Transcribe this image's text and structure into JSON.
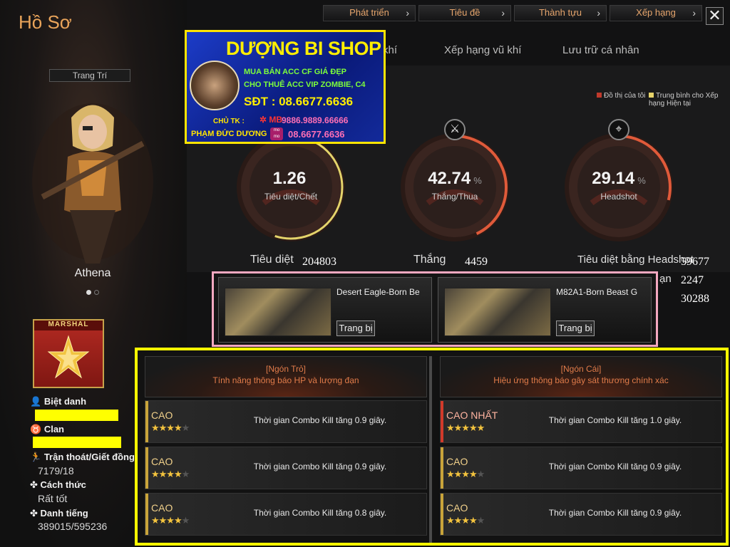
{
  "window": {
    "title": "Hồ Sơ"
  },
  "top_tabs": [
    {
      "label": "Phát triển"
    },
    {
      "label": "Tiêu đề"
    },
    {
      "label": "Thành tựu"
    },
    {
      "label": "Xếp hạng"
    }
  ],
  "close_icon": "close-icon",
  "nav_tabs": [
    {
      "label": "khí"
    },
    {
      "label": "Xếp hạng vũ khí"
    },
    {
      "label": "Lưu trữ cá nhân"
    }
  ],
  "character": {
    "decoration_label": "Trang Trí",
    "name": "Athena",
    "rank_label": "MARSHAL"
  },
  "profile": {
    "nickname_label": "Biệt danh",
    "clan_label": "Clan",
    "escape_label": "Trận thoát/Giết đồng đ",
    "escape_value": "7179/18",
    "manner_label": "Cách thức",
    "manner_value": "Rất tốt",
    "reputation_label": "Danh tiếng",
    "reputation_value": "389015/595236"
  },
  "legend": {
    "mine": "Đồ thị của tôi",
    "average": "Trung bình cho Xếp hạng Hiện tại",
    "mine_color": "#c0392b",
    "average_color": "#e6d36a"
  },
  "gauges": [
    {
      "value": "1.26",
      "unit": "",
      "label": "Tiêu diệt/Chết",
      "fraction": 0.55,
      "icon": ""
    },
    {
      "value": "42.74",
      "unit": "%",
      "label": "Thắng/Thua",
      "fraction": 0.43,
      "icon": "crossed-rifles-icon"
    },
    {
      "value": "29.14",
      "unit": "%",
      "label": "Headshot",
      "fraction": 0.29,
      "icon": "sniper-icon"
    }
  ],
  "stats": {
    "kills_label": "Tiêu diệt",
    "kills_value": "204803",
    "wins_label": "Thắng",
    "wins_value": "4459",
    "headshot_kills_label": "Tiêu diệt bằng Headshot",
    "headshot_kills_value": "59677",
    "row2_label_fragment": "ạn",
    "row2_value": "2247",
    "row3_value": "30288"
  },
  "weapons": [
    {
      "name": "Desert Eagle-Born Be",
      "button": "Trang bị"
    },
    {
      "name": "M82A1-Born Beast G",
      "button": "Trang bị"
    }
  ],
  "effects": {
    "left": {
      "title": "[Ngón Trỏ]",
      "subtitle": "Tính năng thông báo HP và lượng đạn",
      "rows": [
        {
          "level": "CAO",
          "stars": "★★★★",
          "empty": "★",
          "desc": "Thời gian Combo Kill tăng 0.9 giây."
        },
        {
          "level": "CAO",
          "stars": "★★★★",
          "empty": "★",
          "desc": "Thời gian Combo Kill tăng 0.9 giây."
        },
        {
          "level": "CAO",
          "stars": "★★★★",
          "empty": "★",
          "desc": "Thời gian Combo Kill tăng 0.8 giây."
        }
      ]
    },
    "right": {
      "title": "[Ngón Cái]",
      "subtitle": "Hiệu ứng thông báo gây sát thương chính xác",
      "rows": [
        {
          "level": "CAO NHẤT",
          "stars": "★★★★★",
          "empty": "",
          "desc": "Thời gian Combo Kill tăng 1.0 giây."
        },
        {
          "level": "CAO",
          "stars": "★★★★",
          "empty": "★",
          "desc": "Thời gian Combo Kill tăng 0.9 giây."
        },
        {
          "level": "CAO",
          "stars": "★★★★",
          "empty": "★",
          "desc": "Thời gian Combo Kill tăng 0.9 giây."
        }
      ]
    }
  },
  "shop_banner": {
    "title": "DƯỢNG BI SHOP",
    "line1": "MUA BÁN ACC CF GIÁ ĐẸP",
    "line2": "CHO THUÊ ACC VIP ZOMBIE, C4",
    "phone": "SĐT : 08.6677.6636",
    "owner_label": "CHỦ TK :",
    "bank": "MB",
    "bank_account": "9886.9889.66666",
    "owner_name": "PHẠM ĐỨC DƯƠNG",
    "momo": "mo mo",
    "momo_phone": "08.6677.6636"
  }
}
